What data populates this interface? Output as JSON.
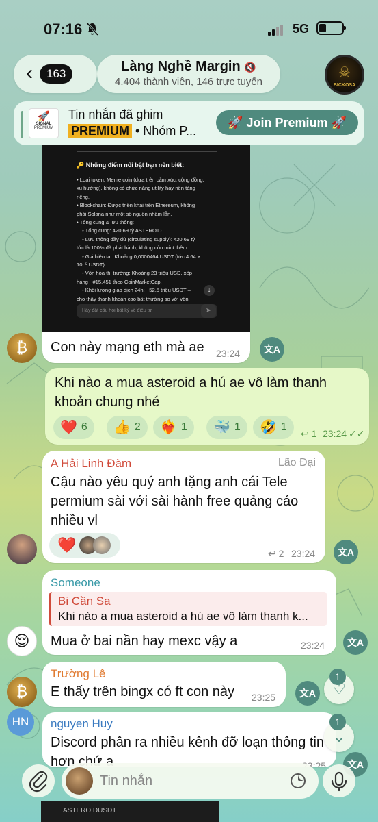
{
  "status_bar": {
    "time": "07:16",
    "network": "5G"
  },
  "header": {
    "back_count": "163",
    "title": "Làng Nghề Margin",
    "subtitle": "4.404 thành viên, 146 trực tuyến",
    "avatar_text": "BICKOSA"
  },
  "pinned": {
    "title": "Tin nhắn đã ghim",
    "premium_tag": "PREMIUM",
    "preview": " • Nhóm P...",
    "thumb_text_1": "SIGNAL",
    "thumb_text_2": "PREMIUM",
    "join_label": "🚀 Join Premium 🚀"
  },
  "screenshot": {
    "heading": "🔑 Những điểm nổi bật bạn nên biết:",
    "lines": [
      "• Loại token: Meme coin (dựa trên cảm xúc, cộng đồng,",
      "xu hướng), không có chức năng utility hay nền tảng",
      "riêng.",
      "• Blockchain: Được triển khai trên Ethereum, không",
      "phải Solana như một số nguồn nhầm lẫn.",
      "• Tổng cung & lưu thông:",
      "◦ Tổng cung: 420,69 tỷ ASTEROID",
      "◦ Lưu thông đầy đủ (circulating supply): 420,69 tỷ →",
      "tức là 100% đã phát hành, không còn mint thêm.",
      "◦ Giá hiện tại: Khoảng 0,0000464 USDT (tức 4.64 ×",
      "10⁻⁵ USDT).",
      "◦ Vốn hóa thị trường: Khoảng 23 triệu USD, xếp",
      "hạng ~#15.451 theo CoinMarketCap.",
      "◦ Khối lượng giao dịch 24h: ~52,5 triệu USDT –",
      "cho thấy thanh khoản cao bất thường so với vốn"
    ],
    "ask_placeholder": "Hãy đặt câu hỏi bất kỳ về điều tự"
  },
  "messages": [
    {
      "text": "Con này mạng eth mà ae",
      "time": "23:24"
    },
    {
      "text": "Khi nào a mua asteroid a hú ae vô làm thanh khoản chung nhé",
      "time": "23:24",
      "replies": "1",
      "reactions": [
        {
          "emoji": "❤️",
          "count": "6"
        },
        {
          "emoji": "👍",
          "count": "2"
        },
        {
          "emoji": "❤️‍🔥",
          "count": "1"
        },
        {
          "emoji": "🐳",
          "count": "1"
        },
        {
          "emoji": "🤣",
          "count": "1"
        }
      ]
    },
    {
      "name": "A Hải Linh Đàm",
      "role": "Lão Đại",
      "text": "Cậu nào yêu quý anh tặng anh cái Tele permium sài với sài hành free quảng cáo nhiều vl",
      "time": "23:24",
      "replies": "2",
      "reaction": "❤️"
    },
    {
      "name": "Someone",
      "quote_name": "Bi Cần Sa",
      "quote_text": "Khi nào a mua asteroid a hú ae vô làm thanh k...",
      "text": "Mua ở bai nần hay mexc vậy a",
      "time": "23:24"
    },
    {
      "name": "Trường Lê",
      "text": "E thấy trên bingx có ft con này",
      "time": "23:25"
    },
    {
      "name": "nguyen Huy",
      "text": "Discord phân ra nhiều kênh đỡ loạn thông tin hơn chứ a",
      "time": "23:25",
      "avatar_initials": "HN"
    }
  ],
  "translate_label": "文A",
  "floating": {
    "reactions_badge": "1",
    "down_badge": "1"
  },
  "composer": {
    "placeholder": "Tin nhắn"
  },
  "bottom_strip": {
    "ticker": "ASTEROIDUSDT"
  },
  "colors": {
    "accent": "#4f8a7e",
    "own_bubble": "#e6f8c8",
    "name_red": "#d04a3a",
    "name_teal": "#3a9aa8",
    "name_orange": "#e07a30",
    "name_blue": "#3a7ac0"
  }
}
